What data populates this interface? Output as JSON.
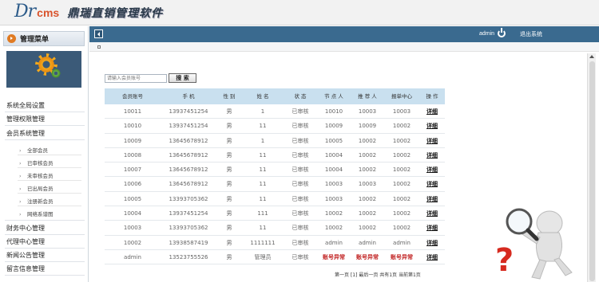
{
  "header": {
    "logo_dr": "Dr",
    "logo_cms": "cms",
    "logo_title": "鼎瑞直销管理软件"
  },
  "topbar": {
    "admin": "admin",
    "logout": "退出系统"
  },
  "sidebar": {
    "title": "管理菜单",
    "sections": [
      "系统全局设置",
      "管理权限管理",
      "会员系统管理",
      "财务中心管理",
      "代理中心管理",
      "新闻公告管理",
      "留言信息管理"
    ],
    "subitems": [
      "全部会员",
      "已审核会员",
      "未审核会员",
      "已出局会员",
      "注册新会员",
      "网络系谱图"
    ]
  },
  "search": {
    "placeholder": "请输入会员账号",
    "button": "搜 索"
  },
  "table": {
    "headers": [
      "会员账号",
      "手 机",
      "性 别",
      "姓 名",
      "状 态",
      "节 点 人",
      "推 荐 人",
      "报单中心",
      "操 作"
    ],
    "rows": [
      [
        "10011",
        "13937451254",
        "男",
        "1",
        "已审核",
        "10010",
        "10003",
        "10003",
        "详细"
      ],
      [
        "10010",
        "13937451254",
        "男",
        "11",
        "已审核",
        "10009",
        "10009",
        "10002",
        "详细"
      ],
      [
        "10009",
        "13645678912",
        "男",
        "1",
        "已审核",
        "10005",
        "10002",
        "10002",
        "详细"
      ],
      [
        "10008",
        "13645678912",
        "男",
        "11",
        "已审核",
        "10004",
        "10002",
        "10002",
        "详细"
      ],
      [
        "10007",
        "13645678912",
        "男",
        "11",
        "已审核",
        "10004",
        "10002",
        "10002",
        "详细"
      ],
      [
        "10006",
        "13645678912",
        "男",
        "11",
        "已审核",
        "10003",
        "10003",
        "10002",
        "详细"
      ],
      [
        "10005",
        "13393705362",
        "男",
        "11",
        "已审核",
        "10003",
        "10002",
        "10002",
        "详细"
      ],
      [
        "10004",
        "13937451254",
        "男",
        "111",
        "已审核",
        "10002",
        "10002",
        "10002",
        "详细"
      ],
      [
        "10003",
        "13393705362",
        "男",
        "11",
        "已审核",
        "10002",
        "10002",
        "10002",
        "详细"
      ],
      [
        "10002",
        "13938587419",
        "男",
        "1111111",
        "已审核",
        "admin",
        "admin",
        "admin",
        "详细"
      ],
      [
        "admin",
        "13523755526",
        "男",
        "管理员",
        "已审核",
        "账号异常",
        "账号异常",
        "账号异常",
        "详细"
      ]
    ]
  },
  "pager": "第一页 [1] 最后一页 共有1页 当前第1页",
  "colors": {
    "topbar": "#3a6a8f",
    "table_header": "#c9e0ef",
    "error_text": "#c02020",
    "logo_accent": "#d9532c"
  }
}
